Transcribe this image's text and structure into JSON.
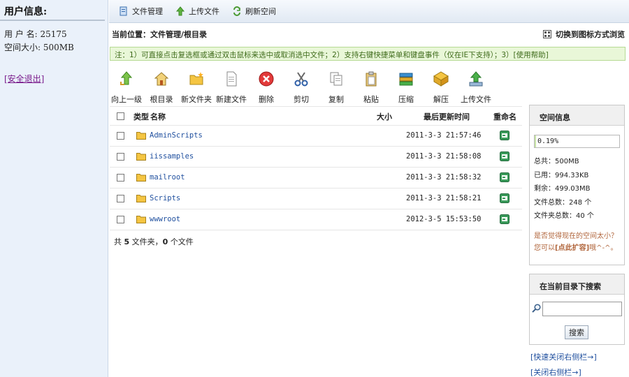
{
  "user_panel": {
    "title": "用户信息:",
    "username": "用 户 名: 25175",
    "space_size": "空间大小: 500MB",
    "logout": "[安全退出]"
  },
  "topbar": {
    "items": [
      {
        "label": "文件管理",
        "icon": "file-manage-icon"
      },
      {
        "label": "上传文件",
        "icon": "upload-arrow-icon"
      },
      {
        "label": "刷新空间",
        "icon": "refresh-icon"
      }
    ]
  },
  "location": {
    "text": "当前位置：文件管理/根目录",
    "switch_view": "切换到图标方式浏览"
  },
  "tip": {
    "text": "注：1）可直接点击复选框或通过双击鼠标来选中或取消选中文件；2）支持右键快捷菜单和键盘事件（仅在IE下支持）；3）",
    "help": "[使用帮助]"
  },
  "actions": [
    {
      "label": "向上一级",
      "icon": "up-level-icon"
    },
    {
      "label": "根目录",
      "icon": "home-icon"
    },
    {
      "label": "新文件夹",
      "icon": "new-folder-icon"
    },
    {
      "label": "新建文件",
      "icon": "new-file-icon"
    },
    {
      "label": "删除",
      "icon": "delete-icon"
    },
    {
      "label": "剪切",
      "icon": "scissors-icon"
    },
    {
      "label": "复制",
      "icon": "copy-icon"
    },
    {
      "label": "粘贴",
      "icon": "paste-icon"
    },
    {
      "label": "压缩",
      "icon": "compress-icon"
    },
    {
      "label": "解压",
      "icon": "extract-icon"
    },
    {
      "label": "上传文件",
      "icon": "upload-icon"
    }
  ],
  "table": {
    "headers": {
      "type": "类型",
      "name": "名称",
      "size": "大小",
      "modified": "最后更新时间",
      "rename": "重命名"
    },
    "rows": [
      {
        "name": "AdminScripts",
        "size": "",
        "modified": "2011-3-3 21:57:46"
      },
      {
        "name": "iissamples",
        "size": "",
        "modified": "2011-3-3 21:58:08"
      },
      {
        "name": "mailroot",
        "size": "",
        "modified": "2011-3-3 21:58:32"
      },
      {
        "name": "Scripts",
        "size": "",
        "modified": "2011-3-3 21:58:21"
      },
      {
        "name": "wwwroot",
        "size": "",
        "modified": "2012-3-5 15:53:50"
      }
    ],
    "summary_prefix": "共",
    "folder_count": "5",
    "summary_middle": "文件夹，",
    "file_count": "0",
    "summary_suffix": "个文件"
  },
  "space_info": {
    "title": "空间信息",
    "usage_percent": "0.19%",
    "usage_fraction": 0.0019,
    "total": "总共：500MB",
    "used": "已用：994.33KB",
    "remaining": "剩余：499.03MB",
    "file_total": "文件总数：248 个",
    "folder_total": "文件夹总数：40 个",
    "hint_before": "是否觉得现在的空间太小？您可以",
    "hint_link": "[点此扩容]",
    "hint_after": "哦^-^。"
  },
  "search": {
    "title": "在当前目录下搜索",
    "value": "",
    "button": "搜索"
  },
  "sidebar_links": {
    "quick_close": "[快速关闭右侧栏→]",
    "close": "[关闭右侧栏→]"
  },
  "colors": {
    "tip_bg": "#e9f7d8",
    "link": "#1f4f9e",
    "folder": "#f5c542",
    "panel_bg": "#eaf1fa"
  }
}
